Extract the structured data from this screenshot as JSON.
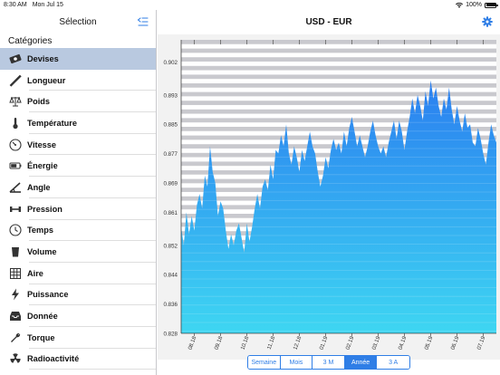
{
  "status_bar": {
    "time": "8:30 AM",
    "date": "Mon Jul 15",
    "battery": "100%",
    "battery_level": 1.0
  },
  "sidebar": {
    "title": "Sélection",
    "section_label": "Catégories",
    "items": [
      {
        "label": "Devises",
        "icon": "money-icon",
        "selected": true
      },
      {
        "label": "Longueur",
        "icon": "ruler-icon"
      },
      {
        "label": "Poids",
        "icon": "scale-icon"
      },
      {
        "label": "Température",
        "icon": "thermometer-icon"
      },
      {
        "label": "Vitesse",
        "icon": "speedometer-icon"
      },
      {
        "label": "Énergie",
        "icon": "battery-icon"
      },
      {
        "label": "Angle",
        "icon": "angle-icon"
      },
      {
        "label": "Pression",
        "icon": "dumbbell-icon"
      },
      {
        "label": "Temps",
        "icon": "clock-icon"
      },
      {
        "label": "Volume",
        "icon": "cup-icon"
      },
      {
        "label": "Aire",
        "icon": "grid-icon"
      },
      {
        "label": "Puissance",
        "icon": "lightning-icon"
      },
      {
        "label": "Donnée",
        "icon": "tray-icon"
      },
      {
        "label": "Torque",
        "icon": "wrench-icon"
      },
      {
        "label": "Radioactivité",
        "icon": "radiation-icon"
      }
    ]
  },
  "main": {
    "title": "USD - EUR",
    "periods": [
      "Semaine",
      "Mois",
      "3 M",
      "Année",
      "3 A"
    ],
    "active_period": "Année"
  },
  "colors": {
    "accent": "#2f7ee6",
    "selected_row": "#b9c9e0",
    "chart_fill_top": "#2a7ef0",
    "chart_fill_bottom": "#3ed6f2"
  },
  "chart_data": {
    "type": "area",
    "title": "",
    "xlabel": "",
    "ylabel": "",
    "y_ticks": [
      "0.828",
      "0.836",
      "0.844",
      "0.852",
      "0.861",
      "0.869",
      "0.877",
      "0.885",
      "0.893",
      "0.902"
    ],
    "ylim": [
      0.828,
      0.908
    ],
    "x_ticks": [
      "08.18",
      "09.18",
      "10.18",
      "11.18",
      "12.18",
      "01.19",
      "02.19",
      "03.19",
      "04.19",
      "05.19",
      "06.19",
      "07.19"
    ],
    "x_tick_positions": [
      0.5,
      1.5,
      2.5,
      3.5,
      4.5,
      5.5,
      6.5,
      7.5,
      8.5,
      9.5,
      10.5,
      11.5
    ],
    "xlim": [
      0,
      12
    ],
    "series": [
      {
        "x": [
          0,
          0.1,
          0.2,
          0.3,
          0.4,
          0.5,
          0.6,
          0.7,
          0.8,
          0.9,
          1.0,
          1.1,
          1.2,
          1.3,
          1.4,
          1.5,
          1.6,
          1.7,
          1.8,
          1.9,
          2.0,
          2.1,
          2.2,
          2.3,
          2.4,
          2.5,
          2.6,
          2.7,
          2.8,
          2.9,
          3.0,
          3.1,
          3.2,
          3.3,
          3.4,
          3.5,
          3.6,
          3.7,
          3.8,
          3.9,
          4.0,
          4.1,
          4.2,
          4.3,
          4.4,
          4.5,
          4.6,
          4.7,
          4.8,
          4.9,
          5.0,
          5.1,
          5.2,
          5.3,
          5.4,
          5.5,
          5.6,
          5.7,
          5.8,
          5.9,
          6.0,
          6.1,
          6.2,
          6.3,
          6.4,
          6.5,
          6.6,
          6.7,
          6.8,
          6.9,
          7.0,
          7.1,
          7.2,
          7.3,
          7.4,
          7.5,
          7.6,
          7.7,
          7.8,
          7.9,
          8.0,
          8.1,
          8.2,
          8.3,
          8.4,
          8.5,
          8.6,
          8.7,
          8.8,
          8.9,
          9.0,
          9.1,
          9.2,
          9.3,
          9.4,
          9.5,
          9.6,
          9.7,
          9.8,
          9.9,
          10.0,
          10.1,
          10.2,
          10.3,
          10.4,
          10.5,
          10.6,
          10.7,
          10.8,
          10.9,
          11.0,
          11.1,
          11.2,
          11.3,
          11.4,
          11.5,
          11.6,
          11.7,
          11.8,
          11.9,
          12.0
        ],
        "y": [
          0.857,
          0.852,
          0.861,
          0.855,
          0.86,
          0.856,
          0.863,
          0.866,
          0.862,
          0.871,
          0.868,
          0.879,
          0.872,
          0.869,
          0.86,
          0.864,
          0.862,
          0.856,
          0.851,
          0.855,
          0.852,
          0.856,
          0.858,
          0.854,
          0.85,
          0.858,
          0.853,
          0.857,
          0.862,
          0.866,
          0.862,
          0.868,
          0.87,
          0.867,
          0.874,
          0.87,
          0.878,
          0.877,
          0.882,
          0.879,
          0.885,
          0.877,
          0.874,
          0.879,
          0.876,
          0.872,
          0.878,
          0.875,
          0.879,
          0.883,
          0.879,
          0.877,
          0.872,
          0.868,
          0.871,
          0.876,
          0.873,
          0.878,
          0.881,
          0.878,
          0.88,
          0.877,
          0.883,
          0.879,
          0.884,
          0.887,
          0.883,
          0.879,
          0.882,
          0.879,
          0.876,
          0.879,
          0.883,
          0.886,
          0.882,
          0.879,
          0.877,
          0.879,
          0.876,
          0.88,
          0.883,
          0.886,
          0.881,
          0.886,
          0.883,
          0.878,
          0.883,
          0.887,
          0.892,
          0.888,
          0.893,
          0.89,
          0.886,
          0.894,
          0.89,
          0.897,
          0.892,
          0.895,
          0.89,
          0.887,
          0.892,
          0.889,
          0.895,
          0.889,
          0.885,
          0.89,
          0.886,
          0.883,
          0.888,
          0.884,
          0.885,
          0.88,
          0.879,
          0.884,
          0.881,
          0.877,
          0.874,
          0.88,
          0.885,
          0.882,
          0.88
        ]
      }
    ]
  }
}
